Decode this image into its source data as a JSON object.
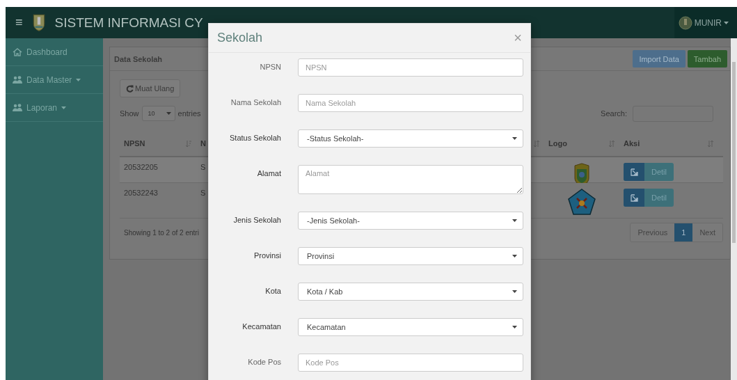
{
  "header": {
    "menu_icon": "≡",
    "title": "SISTEM INFORMASI CY",
    "user": "MUNIR"
  },
  "sidebar": {
    "items": [
      {
        "label": "Dashboard",
        "dropdown": false
      },
      {
        "label": "Data Master",
        "dropdown": true
      },
      {
        "label": "Laporan",
        "dropdown": true
      }
    ]
  },
  "panel": {
    "title": "Data Sekolah",
    "buttons": [
      {
        "label": "Import Data",
        "kind": "info"
      },
      {
        "label": "Tambah",
        "kind": "success"
      }
    ],
    "reload": "Muat Ulang",
    "show_label": "Show",
    "page_size": "10",
    "entries_label": "entries",
    "search_label": "Search:",
    "table": {
      "columns": [
        {
          "label": "NPSN",
          "sorted": true
        },
        {
          "label": "N"
        },
        {
          "sorted": false
        },
        {
          "label": "Logo",
          "sorted": false
        },
        {
          "label": "Aksi",
          "sorted": false
        }
      ],
      "rows": [
        {
          "npsn": "20532205",
          "name": "S",
          "action": "Detil"
        },
        {
          "npsn": "20532243",
          "name": "S",
          "action": "Detil"
        }
      ]
    },
    "info": "Showing 1 to 2 of 2 entri",
    "pagination": [
      {
        "label": "Previous",
        "selected": false
      },
      {
        "label": "1",
        "selected": true
      },
      {
        "label": "Next",
        "selected": false
      }
    ]
  },
  "modal": {
    "title": "Sekolah",
    "close": "×",
    "fields": [
      {
        "label": "NPSN",
        "kind": "input",
        "placeholder": "NPSN"
      },
      {
        "label": "Nama Sekolah",
        "kind": "input",
        "placeholder": "Nama Sekolah"
      },
      {
        "label": "Status Sekolah",
        "kind": "select",
        "value": "-Status Sekolah-"
      },
      {
        "label": "Alamat",
        "kind": "textarea",
        "placeholder": "Alamat"
      },
      {
        "label": "Jenis Sekolah",
        "kind": "select",
        "value": "-Jenis Sekolah-"
      },
      {
        "label": "Provinsi",
        "kind": "select",
        "value": "Provinsi"
      },
      {
        "label": "Kota",
        "kind": "select",
        "value": "Kota / Kab"
      },
      {
        "label": "Kecamatan",
        "kind": "select",
        "value": "Kecamatan"
      },
      {
        "label": "Kode Pos",
        "kind": "input",
        "placeholder": "Kode Pos"
      }
    ]
  }
}
